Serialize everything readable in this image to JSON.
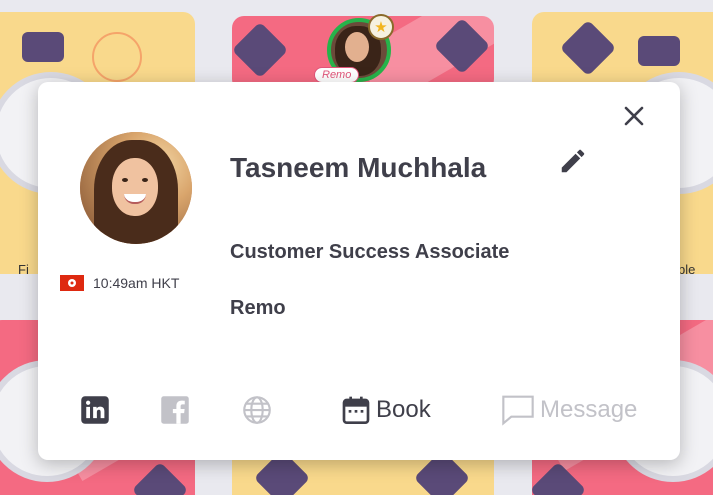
{
  "background": {
    "table_labels": [
      "Fi",
      "ble"
    ],
    "presence_tag": "Remo"
  },
  "profile": {
    "name": "Tasneem Muchhala",
    "job_title": "Customer Success Associate",
    "company": "Remo",
    "local_time": "10:49am HKT",
    "flag_region": "Hong Kong"
  },
  "actions": {
    "book_label": "Book",
    "message_label": "Message"
  },
  "colors": {
    "text": "#3f3f4a",
    "muted": "#c2c2c8",
    "online": "#27b34a",
    "table_yellow": "#f9d98c",
    "table_pink": "#f46a82"
  },
  "icons": [
    "close-icon",
    "edit-pencil-icon",
    "linkedin-icon",
    "facebook-icon",
    "globe-icon",
    "calendar-icon",
    "message-icon",
    "star-icon",
    "hong-kong-flag-icon"
  ]
}
